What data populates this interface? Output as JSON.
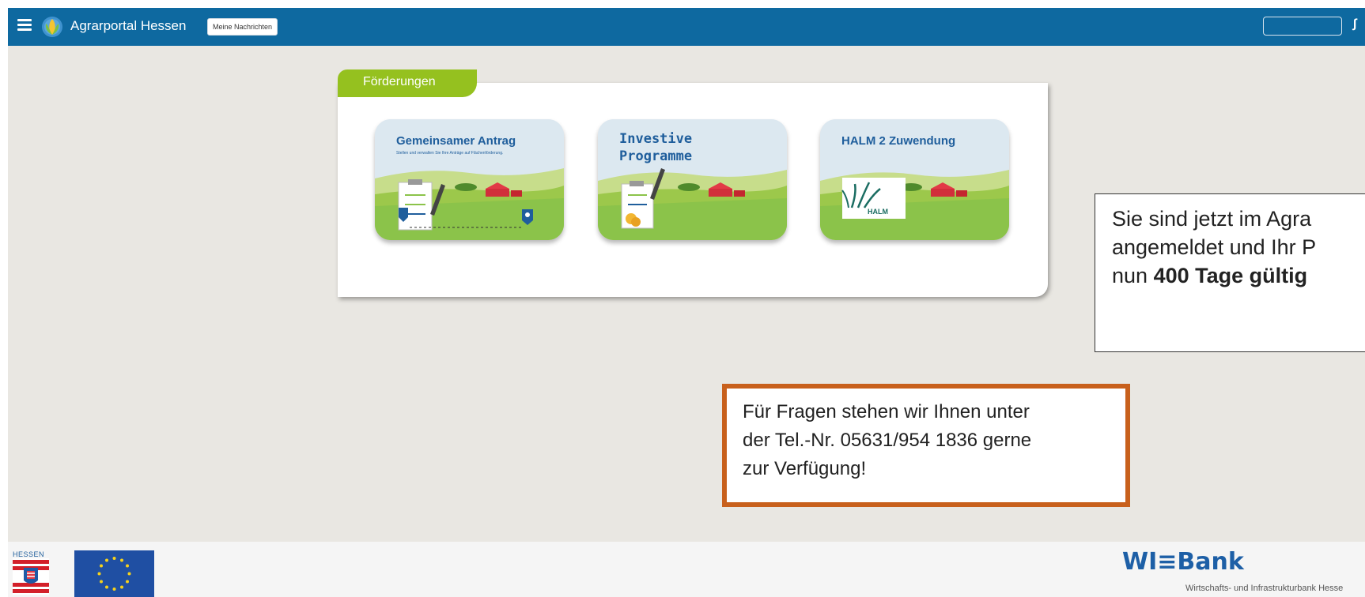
{
  "header": {
    "app_title": "Agrarportal Hessen",
    "messages_button": "Meine Nachrichten",
    "right_mark": "∫"
  },
  "panel": {
    "tab_label": "Förderungen",
    "cards": [
      {
        "title": "Gemeinsamer Antrag",
        "subtitle": "Stellen und verwalten Sie Ihre Anträge auf Flächenförderung."
      },
      {
        "title": "Investive Programme"
      },
      {
        "title": "HALM 2 Zuwendung",
        "logo_text": "HALM"
      }
    ]
  },
  "info_box": {
    "line1": "Sie sind jetzt im Agra",
    "line2": "angemeldet und Ihr P",
    "line3_prefix": "nun ",
    "line3_bold": "400 Tage gültig"
  },
  "contact_box": {
    "line1": "Für Fragen stehen wir Ihnen unter",
    "line2": "der Tel.-Nr. 05631/954 1836 gerne",
    "line3": "zur Verfügung!"
  },
  "footer": {
    "hessen_label": "HESSEN",
    "wibank_logo": "WI≡Bank",
    "wibank_subtitle": "Wirtschafts- und Infrastrukturbank Hesse"
  },
  "colors": {
    "header_bg": "#0e69a0",
    "tab_green": "#95c11f",
    "card_title": "#1f5e9c",
    "contact_border": "#c8601c"
  }
}
